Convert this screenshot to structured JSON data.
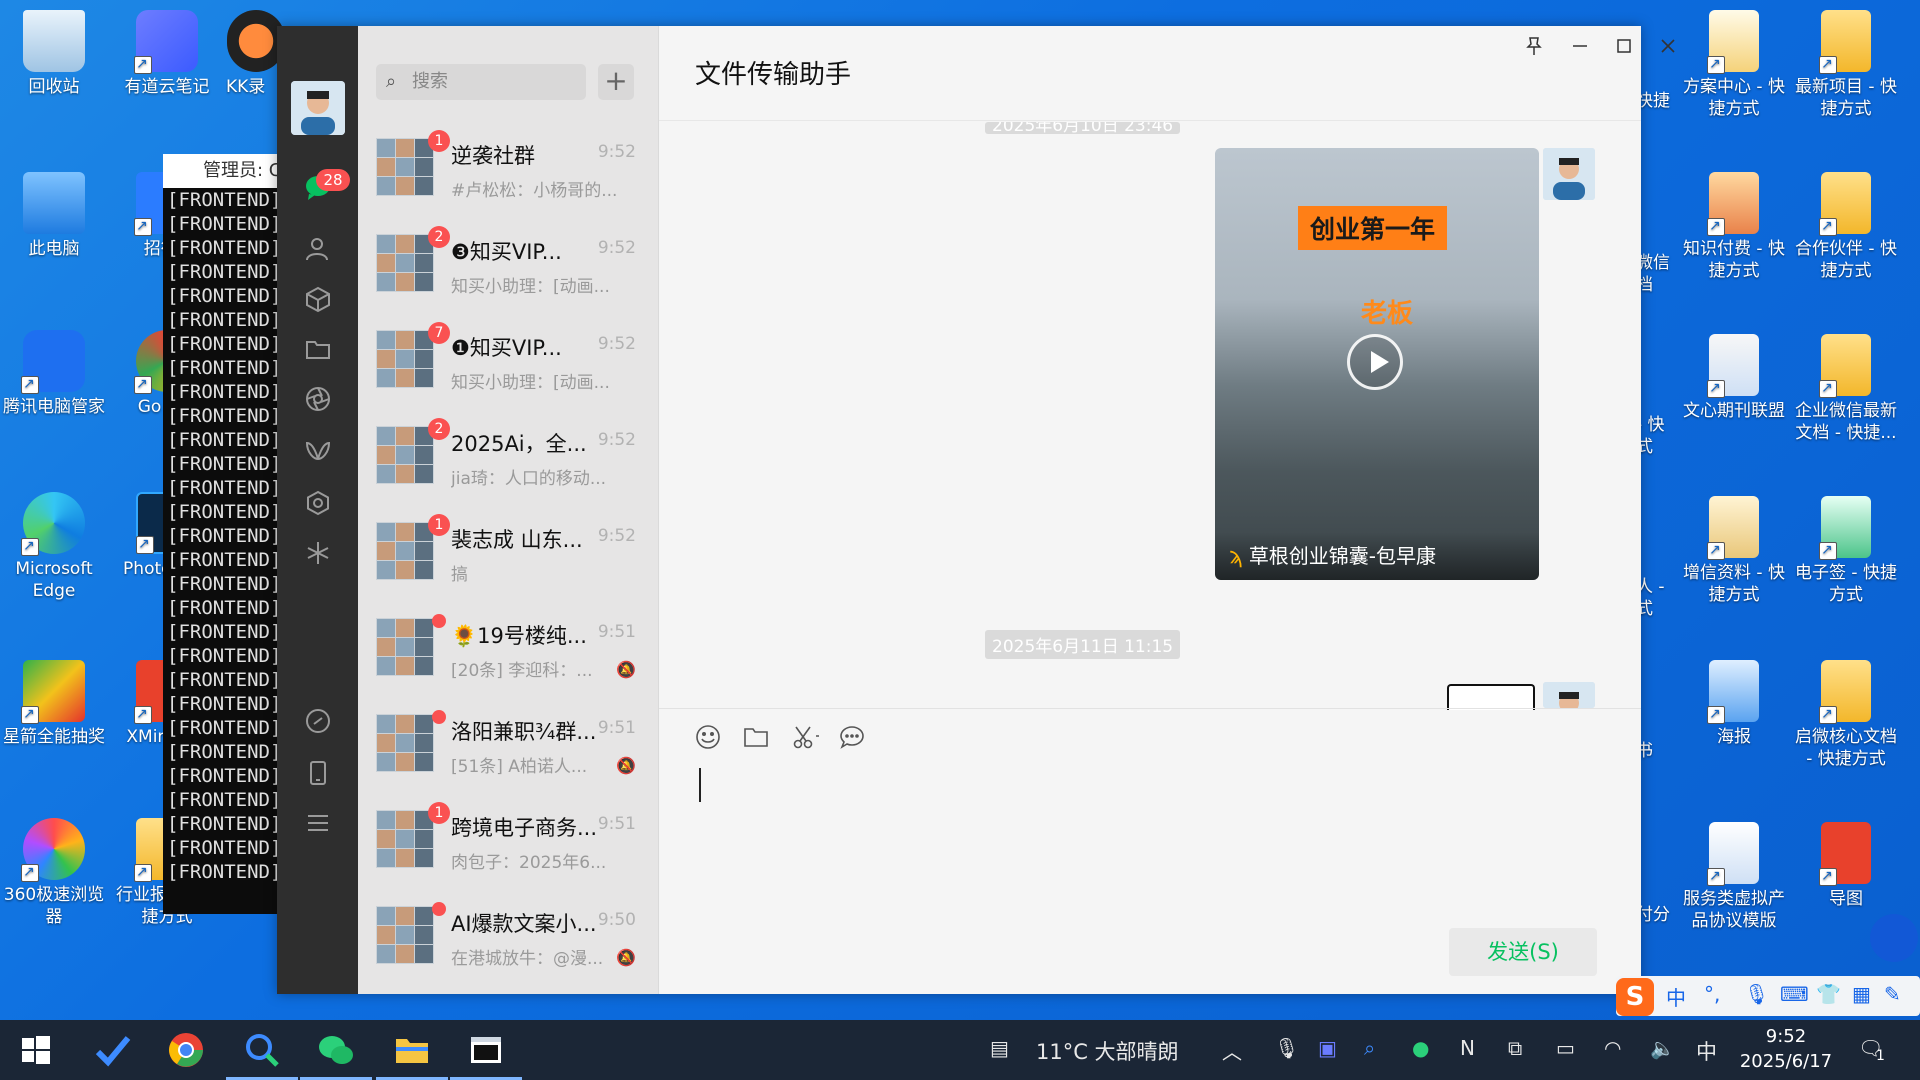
{
  "desktop": {
    "icons_left": [
      {
        "label": "回收站"
      },
      {
        "label": "此电脑"
      },
      {
        "label": "腾讯电脑管家"
      },
      {
        "label": "Microsoft Edge"
      },
      {
        "label": "星箭全能抽奖"
      },
      {
        "label": "360极速浏览器"
      }
    ],
    "icons_col2": [
      {
        "label": "有道云笔记"
      },
      {
        "label": "招行U"
      },
      {
        "label": "Go Chr"
      },
      {
        "label": "Photo 快捷"
      },
      {
        "label": "XMin 快捷"
      },
      {
        "label": "行业报告 - 快捷方式"
      }
    ],
    "icon_col3_top": "KK录",
    "icons_right_a": [
      {
        "label": "方案中心 - 快捷方式"
      },
      {
        "label": "知识付费 - 快捷方式"
      },
      {
        "label": "文心期刊联盟"
      },
      {
        "label": "增信资料 - 快捷方式"
      },
      {
        "label": "海报"
      },
      {
        "label": "服务类虚拟产品协议模版"
      }
    ],
    "icons_right_b": [
      {
        "label": "最新项目 - 快捷方式"
      },
      {
        "label": "合作伙伴 - 快捷方式"
      },
      {
        "label": "企业微信最新文档 - 快捷..."
      },
      {
        "label": "电子签 - 快捷方式"
      },
      {
        "label": "启微核心文档 - 快捷方式"
      },
      {
        "label": "导图"
      }
    ],
    "partial_right": [
      "快捷",
      "微信",
      "档",
      "- 快",
      "式",
      "人 -",
      "式",
      "书",
      "付分"
    ]
  },
  "console": {
    "title": "管理员: C",
    "line_text": "[FRONTEND]",
    "line_count": 29
  },
  "wechat": {
    "nav_badge": "28",
    "search_placeholder": "搜索",
    "add_label": "+",
    "chats": [
      {
        "name": "逆袭社群",
        "time": "9:52",
        "preview": "#卢松松：小杨哥的...",
        "badge": "1"
      },
      {
        "name": "❸知买VIP...",
        "time": "9:52",
        "preview": "知买小助理：[动画...",
        "badge": "2"
      },
      {
        "name": "❶知买VIP...",
        "time": "9:52",
        "preview": "知买小助理：[动画...",
        "badge": "7"
      },
      {
        "name": "2025Ai，全...",
        "time": "9:52",
        "preview": "jia琦：人口的移动...",
        "badge": "2"
      },
      {
        "name": "裴志成 山东...",
        "time": "9:52",
        "preview": "搞",
        "badge": "1"
      },
      {
        "name": "🌻19号楼纯...",
        "time": "9:51",
        "preview": "[20条] 李迎科：...",
        "badge": ""
      },
      {
        "name": "洛阳兼职¾群...",
        "time": "9:51",
        "preview": "[51条] A柏诺人...",
        "badge": ""
      },
      {
        "name": "跨境电子商务...",
        "time": "9:51",
        "preview": "肉包子：2025年6...",
        "badge": "1"
      },
      {
        "name": "AI爆款文案小...",
        "time": "9:50",
        "preview": "在港城放牛：@漫...",
        "badge": ""
      }
    ],
    "chat_title": "文件传输助手",
    "top_stamp": "2025年6月10日 23:46",
    "video": {
      "headline": "创业第一年",
      "overlay": "老板",
      "caption": "草根创业锦囊-包早康"
    },
    "mid_stamp": "2025年6月11日 11:15",
    "send_label": "发送(S)"
  },
  "taskbar": {
    "weather": "11°C 大部晴朗",
    "ime_lang": "中",
    "time": "9:52",
    "date": "2025/6/17",
    "notif": "1"
  },
  "ime_bar": {
    "lang": "中",
    "punct": "°,"
  }
}
